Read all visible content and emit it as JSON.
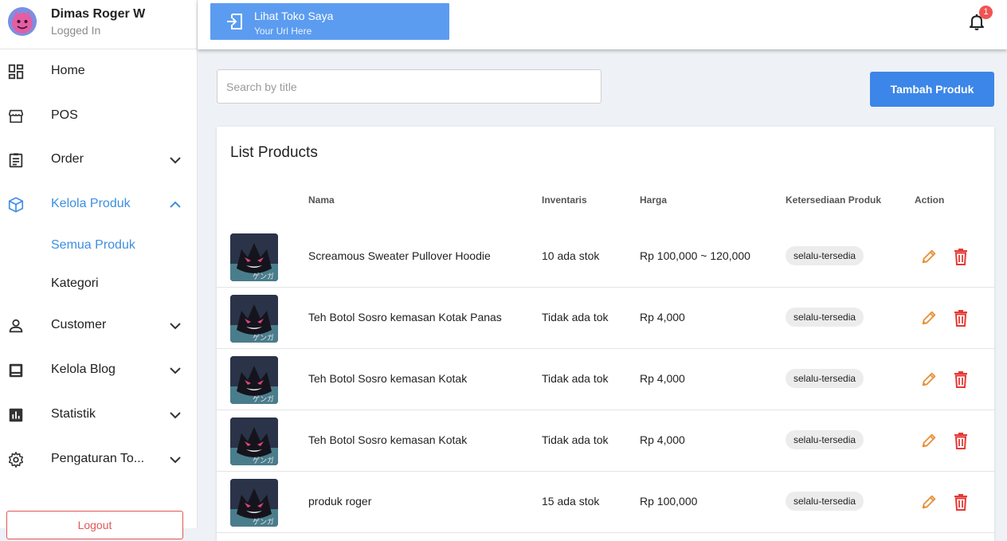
{
  "user": {
    "name": "Dimas Roger W",
    "status": "Logged In"
  },
  "sidebar": {
    "items": [
      {
        "label": "Home",
        "icon": "dashboard-icon"
      },
      {
        "label": "POS",
        "icon": "store-icon"
      },
      {
        "label": "Order",
        "icon": "clipboard-icon",
        "expandable": true
      },
      {
        "label": "Kelola Produk",
        "icon": "box-icon",
        "expandable": true,
        "expanded": true,
        "active": true
      },
      {
        "label": "Customer",
        "icon": "person-icon",
        "expandable": true
      },
      {
        "label": "Kelola Blog",
        "icon": "blog-icon",
        "expandable": true
      },
      {
        "label": "Statistik",
        "icon": "chart-icon",
        "expandable": true
      },
      {
        "label": "Pengaturan To...",
        "icon": "gear-icon",
        "expandable": true
      }
    ],
    "sub_items": [
      {
        "label": "Semua Produk",
        "active": true
      },
      {
        "label": "Kategori"
      }
    ],
    "logout_label": "Logout"
  },
  "topbar": {
    "store_title": "Lihat Toko Saya",
    "store_url": "Your Url Here",
    "notification_count": "1"
  },
  "main": {
    "search_placeholder": "Search by title",
    "add_button": "Tambah Produk",
    "list_title": "List Products",
    "columns": [
      "Nama",
      "Inventaris",
      "Harga",
      "Ketersediaan Produk",
      "Action"
    ],
    "products": [
      {
        "name": "Screamous Sweater Pullover Hoodie",
        "inventory": "10 ada stok",
        "price": "Rp 100,000 ~ 120,000",
        "availability": "selalu-tersedia"
      },
      {
        "name": "Teh Botol Sosro kemasan Kotak Panas",
        "inventory": "Tidak ada tok",
        "price": "Rp 4,000",
        "availability": "selalu-tersedia"
      },
      {
        "name": "Teh Botol Sosro kemasan Kotak",
        "inventory": "Tidak ada tok",
        "price": "Rp 4,000",
        "availability": "selalu-tersedia"
      },
      {
        "name": "Teh Botol Sosro kemasan Kotak",
        "inventory": "Tidak ada tok",
        "price": "Rp 4,000",
        "availability": "selalu-tersedia"
      },
      {
        "name": "produk roger",
        "inventory": "15 ada stok",
        "price": "Rp 100,000",
        "availability": "selalu-tersedia"
      }
    ]
  },
  "colors": {
    "accent": "#3b86e8",
    "store_button": "#5b9cf0",
    "active_nav": "#3d8fe0",
    "edit": "#e8913a",
    "delete": "#e53935",
    "logout": "#e05757"
  }
}
